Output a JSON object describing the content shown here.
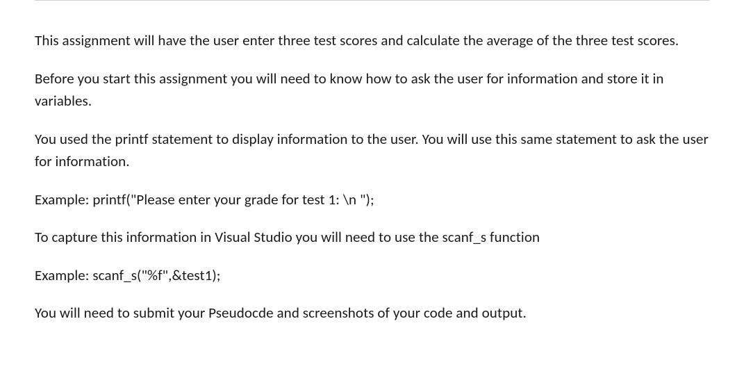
{
  "paragraphs": {
    "p1": "This assignment will have the user enter three test scores and calculate the average of the three test scores.",
    "p2": "Before you start this assignment you will need to know how to ask the user for information and store it in variables.",
    "p3": "You used the printf statement to display information to the user.  You will use this same statement to ask the user for information.",
    "p4": "Example:  printf(\"Please enter your grade for test 1: \\n \");",
    "p5": "To capture this information in Visual Studio you will need to use the scanf_s function",
    "p6": "Example:  scanf_s(\"%f\",&test1);",
    "p7": "You will need to submit your Pseudocde and screenshots of your code and output."
  }
}
